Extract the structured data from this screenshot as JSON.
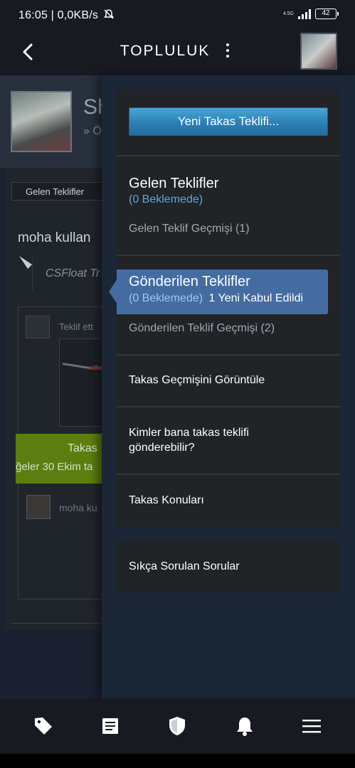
{
  "status_bar": {
    "time_speed": "16:05 | 0,0KB/s",
    "network": "4.5G",
    "battery": "42"
  },
  "header": {
    "title": "TOPLULUK"
  },
  "background": {
    "profile_name": "Sh",
    "breadcrumb": "» Ö",
    "tab": "Gelen Teklifler",
    "user_line": "moha kullan",
    "partner": "CSFloat Tr",
    "offer_text": "Teklif ett",
    "banner_line1": "Takas",
    "banner_line2": "ğeler 30 Ekim ta",
    "user_short": "moha ku"
  },
  "drawer": {
    "new_offer_button": "Yeni Takas Teklifi...",
    "incoming": {
      "title": "Gelen Teklifler",
      "pending": "(0 Beklemede)",
      "history": "Gelen Teklif Geçmişi (1)"
    },
    "sent": {
      "title": "Gönderilen Teklifler",
      "pending": "(0 Beklemede)",
      "accepted": "1 Yeni Kabul Edildi",
      "history": "Gönderilen Teklif Geçmişi (2)"
    },
    "view_history": "Takas Geçmişini Görüntüle",
    "who_can_send": "Kimler bana takas teklifi gönderebilir?",
    "topics": "Takas Konuları",
    "faq": "Sıkça Sorulan Sorular"
  },
  "bottom_nav": {
    "items": [
      "tag-icon",
      "news-icon",
      "shield-icon",
      "bell-icon",
      "menu-icon"
    ]
  }
}
